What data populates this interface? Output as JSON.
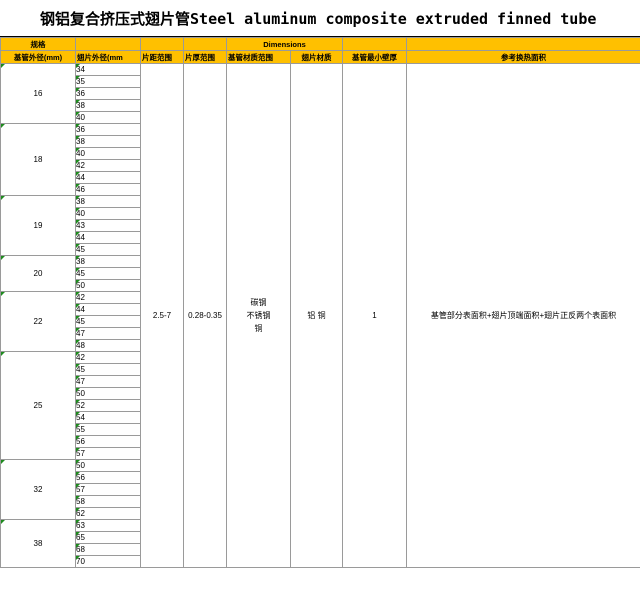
{
  "title": "钢铝复合挤压式翅片管Steel aluminum composite extruded finned tube",
  "header_row1": {
    "spec": "规格",
    "dimensions": "Dimensions"
  },
  "header_row2": {
    "base_od": "基管外径(mm)",
    "fin_od": "翅片外径(mm",
    "fin_pitch": "片距范围",
    "fin_thickness": "片厚范围",
    "base_material": "基管材质范围",
    "fin_material": "翅片材质",
    "min_wall": "基管最小壁厚",
    "surface": "参考换热面积"
  },
  "groups": [
    {
      "od": "16",
      "fins": [
        "34",
        "35",
        "36",
        "38",
        "40"
      ]
    },
    {
      "od": "18",
      "fins": [
        "36",
        "38",
        "40",
        "42",
        "44",
        "46"
      ]
    },
    {
      "od": "19",
      "fins": [
        "38",
        "40",
        "43",
        "44",
        "45"
      ]
    },
    {
      "od": "20",
      "fins": [
        "38",
        "45",
        "50"
      ]
    },
    {
      "od": "22",
      "fins": [
        "42",
        "44",
        "45",
        "47",
        "48"
      ]
    },
    {
      "od": "25",
      "fins": [
        "42",
        "45",
        "47",
        "50",
        "52",
        "54",
        "55",
        "56",
        "57"
      ]
    },
    {
      "od": "32",
      "fins": [
        "50",
        "56",
        "57",
        "58",
        "62"
      ]
    },
    {
      "od": "38",
      "fins": [
        "63",
        "65",
        "68",
        "70"
      ]
    }
  ],
  "merged": {
    "fin_pitch": "2.5-7",
    "fin_thickness": "0.28-0.35",
    "base_material_lines": [
      "碳钢",
      "不锈钢",
      "铜"
    ],
    "fin_material": "铝 铜",
    "min_wall": "1",
    "surface": "基管部分表面积+翅片顶端面积+翅片正反两个表面积"
  },
  "colors": {
    "header_fill": "#ffc000",
    "comment_marker": "#1e8a1e"
  }
}
